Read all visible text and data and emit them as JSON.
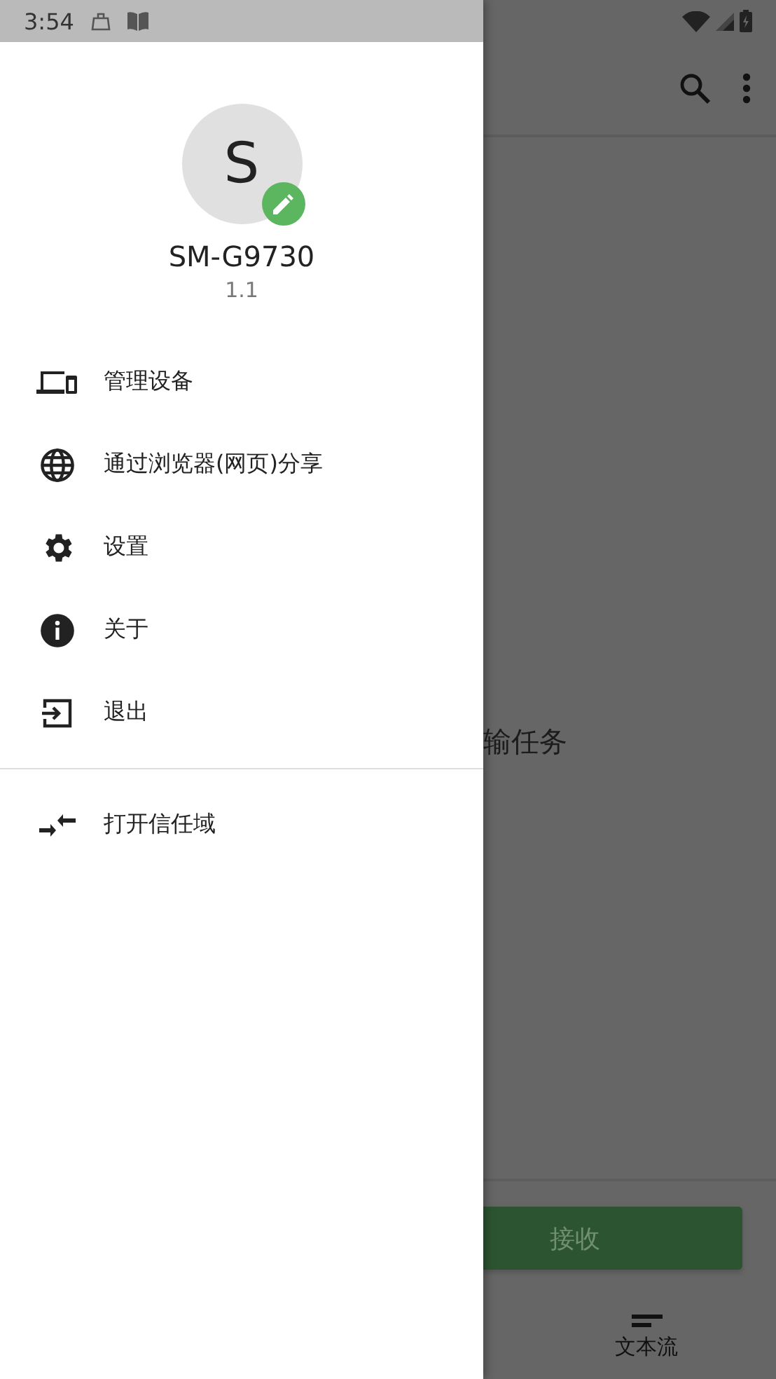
{
  "status_bar": {
    "time": "3:54"
  },
  "main": {
    "empty_text": "输任务",
    "receive_button": "接收"
  },
  "bottom_nav": [
    {
      "label": "文本流",
      "kind": "text-stream"
    }
  ],
  "drawer": {
    "avatar_letter": "S",
    "device_name": "SM-G9730",
    "version": "1.1",
    "menu": [
      {
        "label": "管理设备",
        "kind": "devices"
      },
      {
        "label": "通过浏览器(网页)分享",
        "kind": "globe"
      },
      {
        "label": "设置",
        "kind": "settings"
      },
      {
        "label": "关于",
        "kind": "info"
      },
      {
        "label": "退出",
        "kind": "exit"
      }
    ],
    "extra_menu": [
      {
        "label": "打开信任域",
        "kind": "trust"
      }
    ]
  }
}
